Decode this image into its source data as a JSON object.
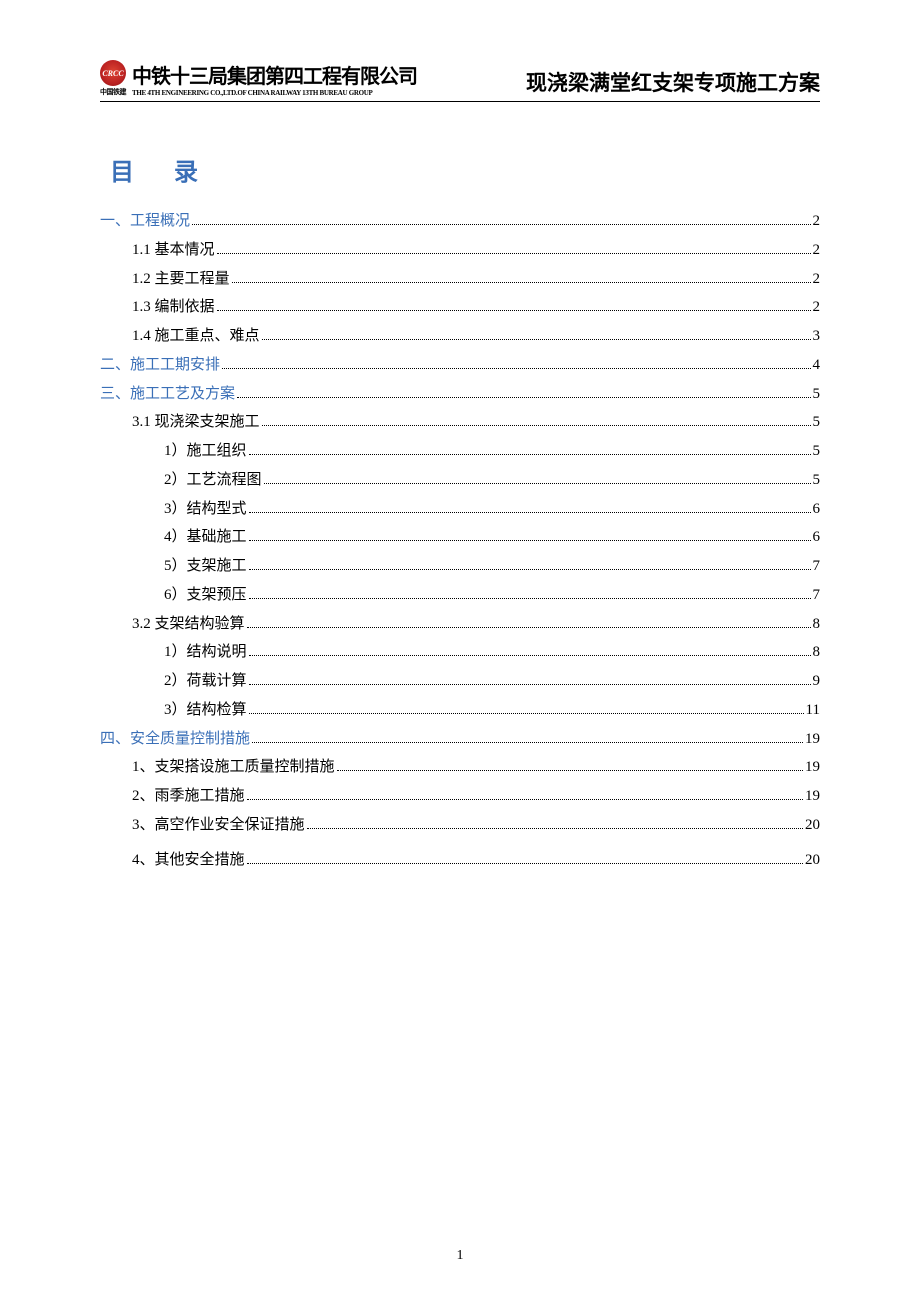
{
  "header": {
    "logo_brand_small": "CRCC",
    "logo_sub": "中国铁建",
    "logo_cn": "中铁十三局集团第四工程有限公司",
    "logo_en": "THE 4TH ENGINEERING CO.,LTD.OF CHINA RAILWAY 13TH BUREAU GROUP",
    "doc_title": "现浇梁满堂红支架专项施工方案"
  },
  "toc_heading": "目录",
  "toc": [
    {
      "level": 1,
      "label": "一、工程概况",
      "page": "2"
    },
    {
      "level": 2,
      "label": "1.1 基本情况",
      "page": "2"
    },
    {
      "level": 2,
      "label": "1.2 主要工程量",
      "page": "2"
    },
    {
      "level": 2,
      "label": "1.3 编制依据",
      "page": "2"
    },
    {
      "level": 2,
      "label": "1.4 施工重点、难点",
      "page": "3"
    },
    {
      "level": 1,
      "label": "二、施工工期安排",
      "page": "4"
    },
    {
      "level": 1,
      "label": "三、施工工艺及方案",
      "page": "5"
    },
    {
      "level": 2,
      "label": "3.1 现浇梁支架施工",
      "page": "5"
    },
    {
      "level": 3,
      "label": "1）施工组织",
      "page": "5"
    },
    {
      "level": 3,
      "label": "2）工艺流程图",
      "page": "5"
    },
    {
      "level": 3,
      "label": "3）结构型式",
      "page": "6"
    },
    {
      "level": 3,
      "label": "4）基础施工",
      "page": "6"
    },
    {
      "level": 3,
      "label": "5）支架施工",
      "page": "7"
    },
    {
      "level": 3,
      "label": "6）支架预压",
      "page": "7"
    },
    {
      "level": 2,
      "label": "3.2 支架结构验算",
      "page": "8"
    },
    {
      "level": 3,
      "label": "1）结构说明",
      "page": "8"
    },
    {
      "level": 3,
      "label": "2）荷载计算",
      "page": "9"
    },
    {
      "level": 3,
      "label": "3）结构检算",
      "page": "11"
    },
    {
      "level": 1,
      "label": "四、安全质量控制措施",
      "page": "19"
    },
    {
      "level": 2,
      "label": "1、支架搭设施工质量控制措施",
      "page": "19"
    },
    {
      "level": 2,
      "label": "2、雨季施工措施",
      "page": "19"
    },
    {
      "level": 2,
      "label": "3、高空作业安全保证措施",
      "page": "20"
    },
    {
      "level": 0,
      "spacer": true
    },
    {
      "level": 2,
      "label": "4、其他安全措施",
      "page": "20"
    }
  ],
  "footer_page": "1"
}
